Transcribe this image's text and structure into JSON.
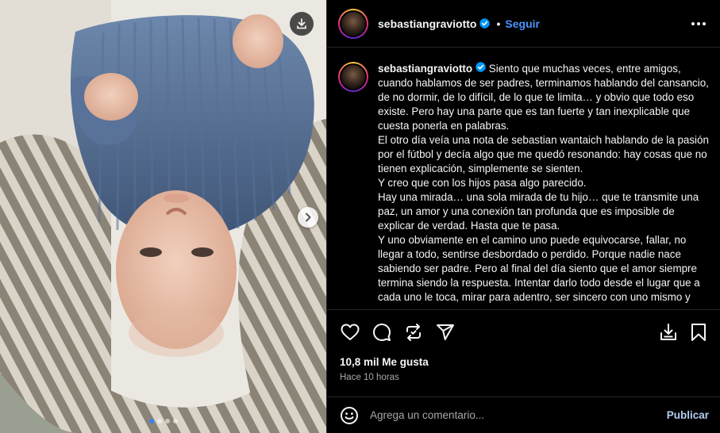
{
  "post": {
    "username": "sebastiangraviotto",
    "follow_label": "Seguir",
    "separator": "•",
    "caption_paragraphs": [
      "Siento que muchas veces, entre amigos, cuando hablamos de ser padres, terminamos hablando del cansancio, de no dormir, de lo difícil, de lo que te limita… y obvio que todo eso existe. Pero hay una parte que es tan fuerte y tan inexplicable que cuesta ponerla en palabras.",
      "El otro día veía una nota de   sebastian wantaich hablando de la pasión por el fútbol y decía algo que me quedó resonando: hay cosas que no tienen explicación, simplemente se sienten.",
      "Y creo que con los hijos pasa algo parecido.",
      "Hay una mirada… una sola mirada de tu hijo… que te transmite una paz, un amor y una conexión tan profunda que es imposible de explicar de verdad. Hasta que te pasa.",
      "Y uno obviamente en el camino uno puede equivocarse, fallar, no llegar a todo, sentirse desbordado o perdido. Porque nadie nace sabiendo ser padre. Pero al final del día siento que el amor siempre termina siendo la respuesta. Intentar darlo todo desde el lugar que a cada uno le toca, mirar para adentro, ser sincero con uno mismo y"
    ],
    "likes": "10,8 mil Me gusta",
    "time_ago": "Hace 10 horas",
    "comment_placeholder": "Agrega un comentario...",
    "publish_label": "Publicar",
    "carousel": {
      "total": 4,
      "active": 1
    }
  },
  "icons": {
    "download": "download-icon",
    "next": "chevron-right-icon",
    "verified": "verified-badge-icon",
    "more": "more-options-icon",
    "like": "heart-icon",
    "comment": "comment-icon",
    "share": "repost-icon",
    "send": "send-icon",
    "save_media": "save-to-device-icon",
    "bookmark": "bookmark-icon",
    "emoji": "emoji-icon"
  },
  "colors": {
    "background": "#000000",
    "link_blue": "#4a93ff",
    "verified_blue": "#0095f6",
    "muted_text": "#a8a8a8",
    "publish_disabled": "#b2cdf2"
  }
}
